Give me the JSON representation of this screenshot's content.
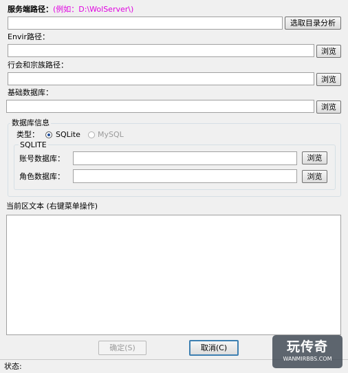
{
  "server_path": {
    "label": "服务端路径：",
    "hint": "(例如：D:\\WolServer\\)",
    "value": "",
    "analyze_button": "选取目录分析"
  },
  "envir_path": {
    "label": "Envir路径：",
    "value": "",
    "browse_button": "浏览"
  },
  "guild_path": {
    "label": "行会和宗族路径：",
    "value": "",
    "browse_button": "浏览"
  },
  "base_db": {
    "label": "基础数据库：",
    "value": "",
    "browse_button": "浏览"
  },
  "db_info": {
    "group_title": "数据库信息",
    "type_label": "类型：",
    "radio_sqlite": "SQLite",
    "radio_mysql": "MySQL",
    "selected": "SQLite",
    "sqlite": {
      "group_title": "SQLITE",
      "account_label": "账号数据库：",
      "account_value": "",
      "account_browse": "浏览",
      "role_label": "角色数据库：",
      "role_value": "",
      "role_browse": "浏览"
    }
  },
  "current_text": {
    "label": "当前区文本 (右键菜单操作)",
    "value": ""
  },
  "buttons": {
    "ok": "确定(S)",
    "cancel": "取消(C)"
  },
  "status": {
    "label": "状态:"
  },
  "watermark": {
    "name": "玩传奇",
    "url": "WANMIRBBS.COM"
  }
}
